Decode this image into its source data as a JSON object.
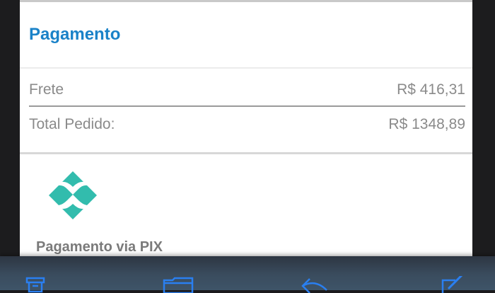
{
  "section": {
    "title": "Pagamento"
  },
  "summary": {
    "rows": [
      {
        "label": "Frete",
        "value": "R$ 416,31"
      },
      {
        "label": "Total Pedido:",
        "value": "R$ 1348,89"
      }
    ]
  },
  "payment": {
    "method_label": "Pagamento via PIX",
    "logo_icon": "pix-logo",
    "logo_color": "#32bcad"
  },
  "toolbar": {
    "accent": "#2a7ff0",
    "icons": [
      "archive-icon",
      "folder-icon",
      "reply-icon",
      "compose-icon"
    ]
  }
}
